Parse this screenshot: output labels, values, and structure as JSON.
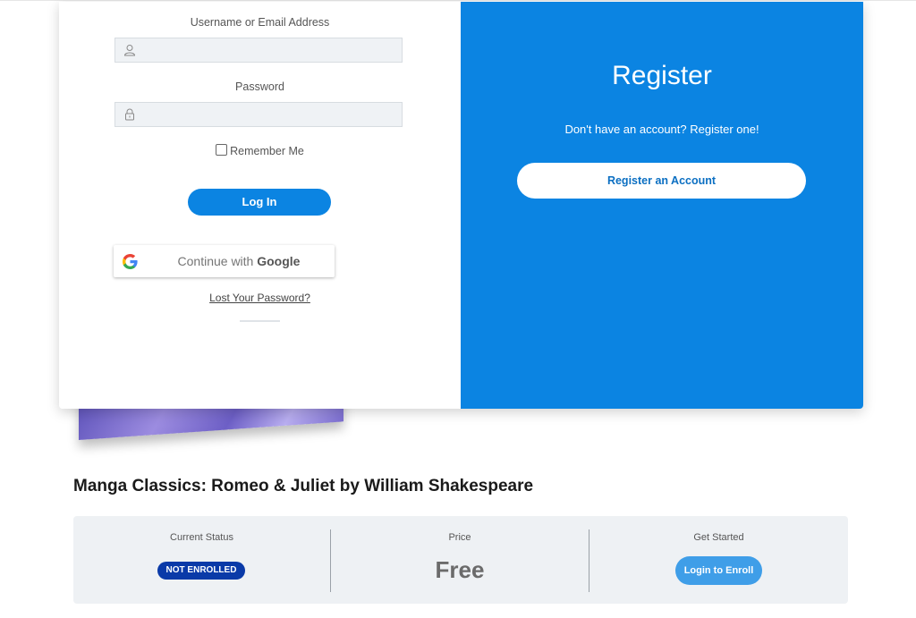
{
  "login": {
    "username_label": "Username or Email Address",
    "username_value": "",
    "password_label": "Password",
    "password_value": "",
    "remember_label": "Remember Me",
    "login_button": "Log In",
    "google_prefix": "Continue with ",
    "google_brand": "Google",
    "lost_password": "Lost Your Password?"
  },
  "register": {
    "title": "Register",
    "text": "Don't have an account? Register one!",
    "button": "Register an Account"
  },
  "course": {
    "title": "Manga Classics: Romeo & Juliet by William Shakespeare",
    "status_label": "Current Status",
    "status_badge": "NOT ENROLLED",
    "price_label": "Price",
    "price_value": "Free",
    "start_label": "Get Started",
    "enroll_button": "Login to Enroll"
  },
  "colors": {
    "accent": "#0b84e2",
    "badge": "#0a3aa8",
    "enroll": "#3f9ee8"
  }
}
